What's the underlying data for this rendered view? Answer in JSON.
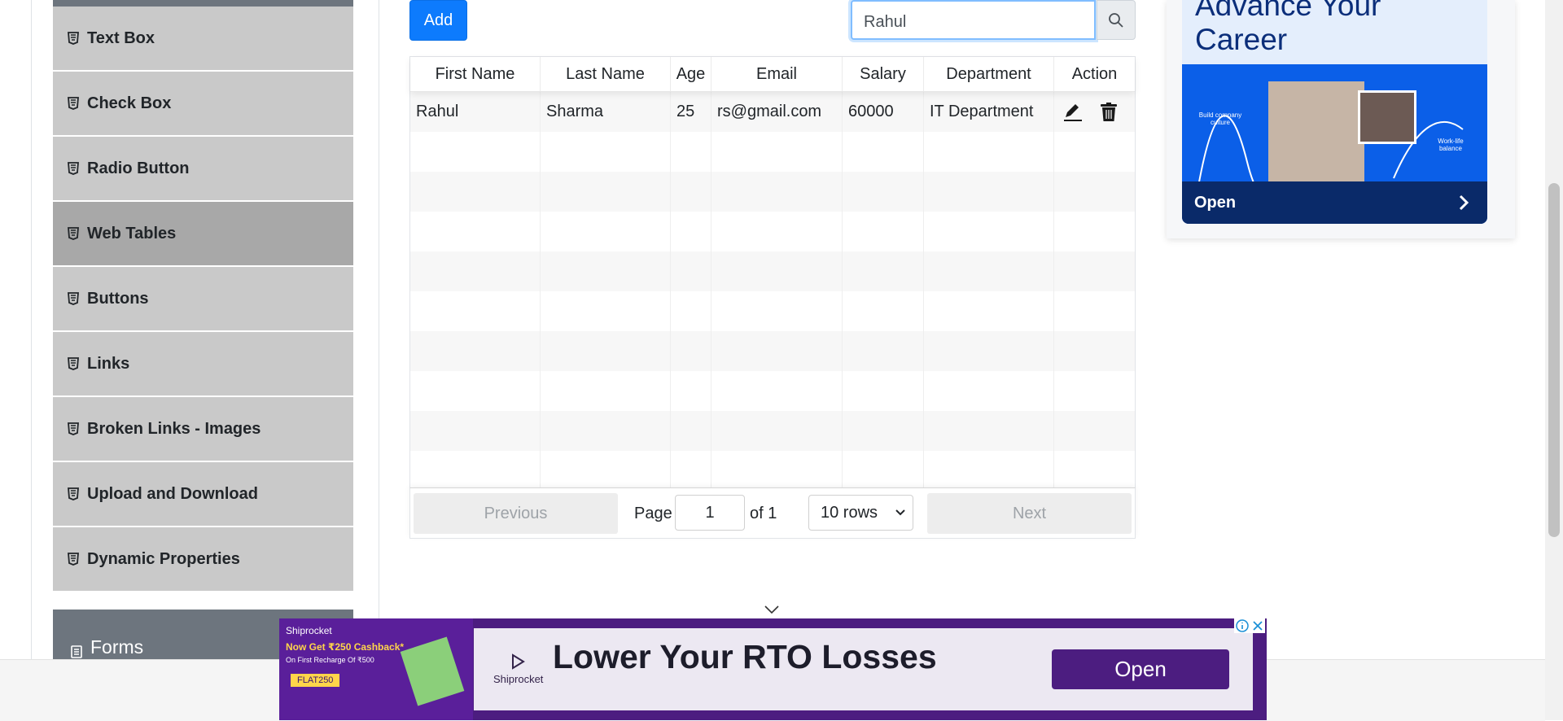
{
  "sidebar": {
    "items": [
      {
        "label": "Text Box"
      },
      {
        "label": "Check Box"
      },
      {
        "label": "Radio Button"
      },
      {
        "label": "Web Tables",
        "active": true
      },
      {
        "label": "Buttons"
      },
      {
        "label": "Links"
      },
      {
        "label": "Broken Links - Images"
      },
      {
        "label": "Upload and Download"
      },
      {
        "label": "Dynamic Properties"
      }
    ],
    "next_group": "Forms"
  },
  "toolbar": {
    "add_label": "Add",
    "search_value": "Rahul"
  },
  "table": {
    "columns": [
      "First Name",
      "Last Name",
      "Age",
      "Email",
      "Salary",
      "Department",
      "Action"
    ],
    "rows": [
      [
        "Rahul",
        "Sharma",
        "25",
        "rs@gmail.com",
        "60000",
        "IT Department"
      ]
    ],
    "empty_rows": 9
  },
  "pagination": {
    "previous": "Previous",
    "page_label": "Page",
    "page_value": "1",
    "of_label": "of 1",
    "rows_option": "10 rows",
    "next": "Next"
  },
  "ad_right": {
    "headline_line1": "Advance Your",
    "headline_line2": "Career",
    "open": "Open",
    "label_left": "Build company culture",
    "label_right": "Work-life balance"
  },
  "ad_bottom": {
    "brand": "Shiprocket",
    "offer_line1": "Now Get ₹250 Cashback*",
    "offer_line2": "On First Recharge Of ₹500",
    "code": "FLAT250",
    "headline": "Lower Your RTO Losses",
    "open": "Open"
  },
  "colors": {
    "primary": "#0d7bfd",
    "sidebar_item": "#c9c9c9",
    "sidebar_active": "#a8a8a8",
    "group_header": "#6d757e",
    "ad_purple": "#4c1d80"
  }
}
